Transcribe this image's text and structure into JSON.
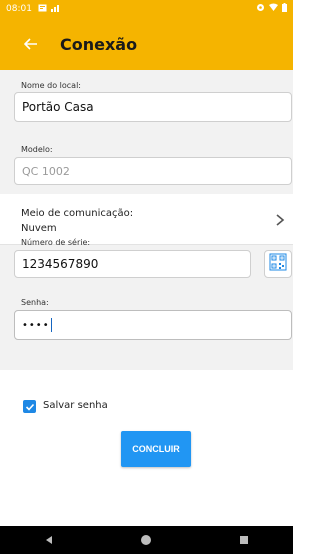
{
  "status_bar": {
    "time": "08:01",
    "left_icons": [
      "message-icon",
      "signal-icon"
    ],
    "right_icons": [
      "vpn-icon",
      "wifi-icon",
      "battery-icon"
    ]
  },
  "app_bar": {
    "title": "Conexão",
    "back_icon": "arrow-left-icon"
  },
  "form": {
    "nome_label": "Nome do local:",
    "nome_value": "Portão Casa",
    "modelo_label": "Modelo:",
    "modelo_value": "QC 1002",
    "meio_label": "Meio de comunicação:",
    "meio_value": "Nuvem",
    "serie_label": "Número de série:",
    "serie_value": "1234567890",
    "senha_label": "Senha:",
    "senha_value": "••••",
    "salvar_label": "Salvar senha",
    "salvar_checked": true,
    "submit_label": "CONCLUIR"
  },
  "colors": {
    "accent": "#f5b400",
    "primary_button": "#2196f3",
    "checkbox": "#1e88e5"
  },
  "nav_bar": {
    "icons": [
      "back-triangle-icon",
      "home-circle-icon",
      "recents-square-icon"
    ]
  }
}
